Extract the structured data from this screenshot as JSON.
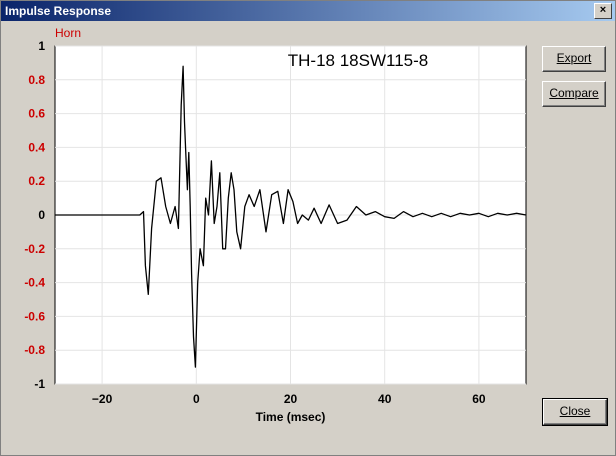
{
  "window": {
    "title": "Impulse Response",
    "close_glyph": "×"
  },
  "buttons": {
    "export": "Export",
    "compare": "Compare",
    "close": "Close"
  },
  "chart_data": {
    "type": "line",
    "title": "TH-18 18SW115-8",
    "series_label": "Horn",
    "xlabel": "Time (msec)",
    "ylabel": "",
    "xlim": [
      -30,
      70
    ],
    "ylim": [
      -1,
      1
    ],
    "xticks": [
      -20,
      0,
      20,
      40,
      60
    ],
    "yticks": [
      1,
      0.8,
      0.6,
      0.4,
      0.2,
      0,
      -0.2,
      -0.4,
      -0.6,
      -0.8,
      -1
    ],
    "grid": true,
    "colors": {
      "line": "#000000",
      "label_red": "#cc0000",
      "plot_bg": "#ffffff",
      "grid": "#e4e4e4"
    },
    "series": [
      {
        "x": [
          -30,
          -12,
          -11.2,
          -10.8,
          -10.2,
          -9.5,
          -8.5,
          -7.5,
          -6.5,
          -5.5,
          -4.5,
          -3.8,
          -3.2,
          -2.8,
          -2.5,
          -2.2,
          -1.9,
          -1.6,
          -1.3,
          -1.0,
          -0.6,
          -0.2,
          0.3,
          0.8,
          1.5,
          2.0,
          2.6,
          3.2,
          3.8,
          4.4,
          5.0,
          5.6,
          6.2,
          6.8,
          7.4,
          8.0,
          8.6,
          9.4,
          10.3,
          11.2,
          12.3,
          13.5,
          14.8,
          16.0,
          17.3,
          18.5,
          19.5,
          20.5,
          21.5,
          22.5,
          23.8,
          25.0,
          26.5,
          28.2,
          30.0,
          32.0,
          34.0,
          36.0,
          38.0,
          40.0,
          42.0,
          44.0,
          46.0,
          48.0,
          50.0,
          52.0,
          54.0,
          56.0,
          58.0,
          60.0,
          62.0,
          64.0,
          66.0,
          68.0,
          70.0
        ],
        "y": [
          0,
          0,
          0.02,
          -0.3,
          -0.47,
          -0.08,
          0.2,
          0.22,
          0.05,
          -0.05,
          0.05,
          -0.08,
          0.65,
          0.88,
          0.55,
          0.35,
          0.15,
          0.37,
          0.05,
          -0.35,
          -0.72,
          -0.9,
          -0.4,
          -0.2,
          -0.3,
          0.1,
          0,
          0.32,
          -0.05,
          0.05,
          0.25,
          -0.2,
          -0.2,
          0.1,
          0.25,
          0.15,
          -0.1,
          -0.2,
          0.05,
          0.12,
          0.05,
          0.15,
          -0.1,
          0.12,
          0.14,
          -0.05,
          0.15,
          0.08,
          -0.05,
          0.0,
          -0.03,
          0.04,
          -0.05,
          0.06,
          -0.05,
          -0.03,
          0.05,
          0.0,
          0.02,
          -0.01,
          -0.02,
          0.02,
          -0.01,
          0.01,
          -0.01,
          0.01,
          -0.01,
          0.01,
          0.0,
          0.01,
          -0.01,
          0.01,
          0.0,
          0.01,
          0.0
        ]
      }
    ]
  }
}
